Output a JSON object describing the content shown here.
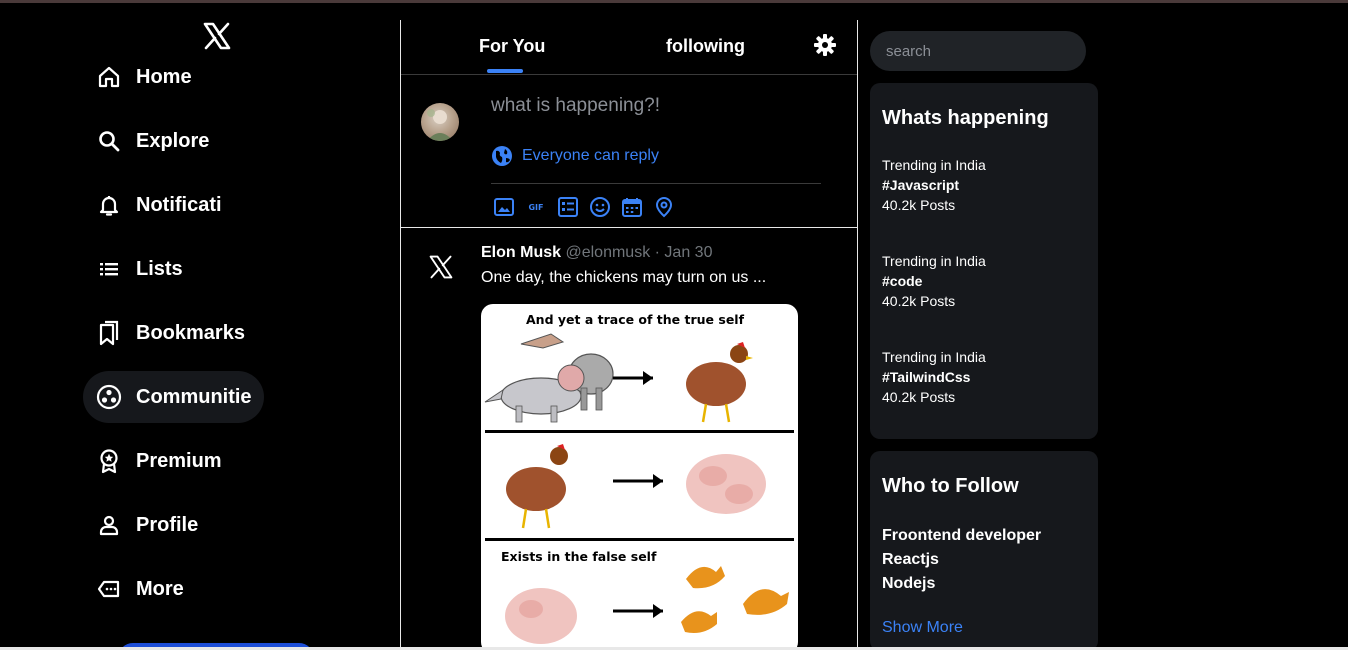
{
  "sidebar": {
    "items": [
      {
        "label": "Home",
        "icon": "home-icon"
      },
      {
        "label": "Explore",
        "icon": "search-icon"
      },
      {
        "label": "Notificati",
        "icon": "bell-icon"
      },
      {
        "label": "Lists",
        "icon": "list-icon"
      },
      {
        "label": "Bookmarks",
        "icon": "bookmark-icon"
      },
      {
        "label": "Communitie",
        "icon": "communities-icon"
      },
      {
        "label": "Premium",
        "icon": "premium-icon"
      },
      {
        "label": "Profile",
        "icon": "profile-icon"
      },
      {
        "label": "More",
        "icon": "more-icon"
      }
    ],
    "active_item": "Communitie"
  },
  "feed": {
    "tabs": [
      {
        "label": "For You"
      },
      {
        "label": "following"
      }
    ],
    "active_tab": "For You",
    "composer": {
      "placeholder": "what is happening?!",
      "reply_setting": "Everyone can reply"
    },
    "tweet": {
      "author": "Elon Musk",
      "handle": "@elonmusk",
      "date": "Jan 30",
      "text": "One day, the chickens may turn on us ...",
      "image_captions": [
        "And yet a trace of the true self",
        "Exists in the false self"
      ]
    }
  },
  "right": {
    "search_placeholder": "search",
    "trending": {
      "title": "Whats happening",
      "items": [
        {
          "context": "Trending in India",
          "tag": "#Javascript",
          "posts": "40.2k Posts"
        },
        {
          "context": "Trending in India",
          "tag": "#code",
          "posts": "40.2k Posts"
        },
        {
          "context": "Trending in India",
          "tag": "#TailwindCss",
          "posts": "40.2k Posts"
        }
      ]
    },
    "who_to_follow": {
      "title": "Who to Follow",
      "items": [
        "Froontend developer",
        "Reactjs",
        "Nodejs"
      ],
      "show_more": "Show More"
    }
  },
  "colors": {
    "accent": "#3b82f6",
    "background": "#000000",
    "card": "#16181c"
  }
}
